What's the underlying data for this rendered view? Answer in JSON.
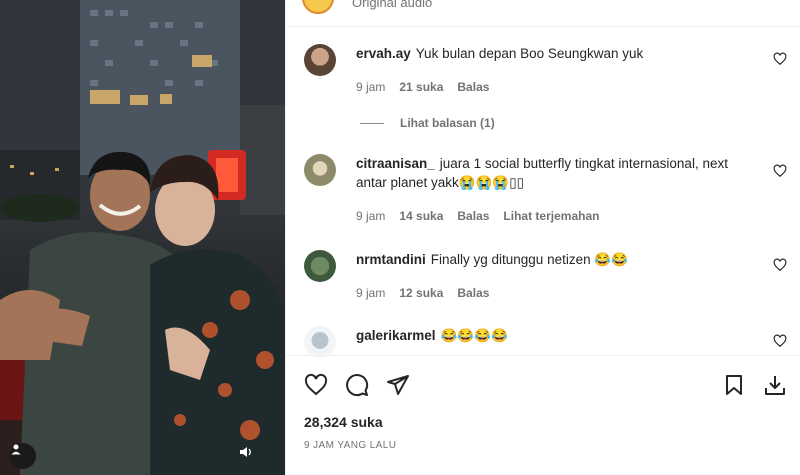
{
  "post": {
    "audio_label": "Original audio",
    "likes_text": "28,324 suka",
    "time_ago": "9 JAM YANG LALU"
  },
  "comments": [
    {
      "username": "ervah.ay",
      "text": "Yuk bulan depan Boo Seungkwan yuk",
      "time": "9 jam",
      "likes": "21 suka",
      "reply": "Balas",
      "view_replies": "Lihat balasan (1)"
    },
    {
      "username": "citraanisan_",
      "text": "juara 1 social butterfly tingkat internasional, next antar planet yakk😭😭😭▯▯",
      "time": "9 jam",
      "likes": "14 suka",
      "reply": "Balas",
      "translate": "Lihat terjemahan"
    },
    {
      "username": "nrmtandini",
      "text": "Finally yg ditunggu netizen 😂😂",
      "time": "9 jam",
      "likes": "12 suka",
      "reply": "Balas"
    },
    {
      "username": "galerikarmel",
      "text": "😂😂😂😂"
    }
  ],
  "icons": {
    "like": "heart-icon",
    "comment": "comment-icon",
    "share": "share-icon",
    "save": "bookmark-icon",
    "download": "download-icon",
    "mute": "speaker-icon",
    "tag": "user-tag-icon"
  }
}
